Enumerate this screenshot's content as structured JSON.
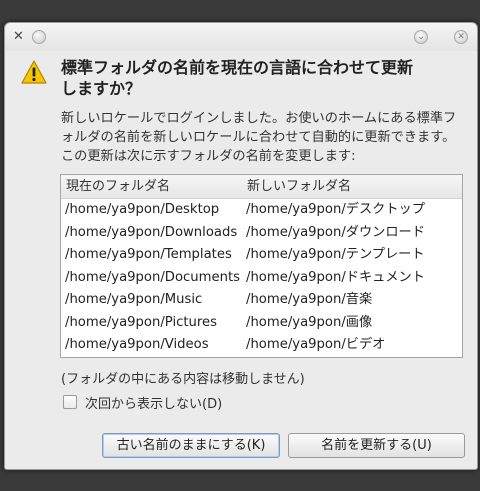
{
  "dialog": {
    "heading": "標準フォルダの名前を現在の言語に合わせて更新しますか？",
    "description": "新しいロケールでログインしました。お使いのホームにある標準フォルダの名前を新しいロケールに合わせて自動的に更新できます。この更新は次に示すフォルダの名前を変更します:",
    "icons": {
      "app": "app-icon",
      "menu": "window-menu-icon",
      "minimize": "minimize-icon",
      "close": "close-icon",
      "warning": "warning-icon"
    }
  },
  "table": {
    "headers": [
      "現在のフォルダ名",
      "新しいフォルダ名"
    ],
    "rows": [
      [
        "/home/ya9pon/Desktop",
        "/home/ya9pon/デスクトップ"
      ],
      [
        "/home/ya9pon/Downloads",
        "/home/ya9pon/ダウンロード"
      ],
      [
        "/home/ya9pon/Templates",
        "/home/ya9pon/テンプレート"
      ],
      [
        "/home/ya9pon/Documents",
        "/home/ya9pon/ドキュメント"
      ],
      [
        "/home/ya9pon/Music",
        "/home/ya9pon/音楽"
      ],
      [
        "/home/ya9pon/Pictures",
        "/home/ya9pon/画像"
      ],
      [
        "/home/ya9pon/Videos",
        "/home/ya9pon/ビデオ"
      ]
    ]
  },
  "note": "(フォルダの中にある内容は移動しません)",
  "checkbox": {
    "label": "次回から表示しない(D)",
    "checked": false
  },
  "buttons": {
    "keep_label": "古い名前のままにする(K)",
    "update_label": "名前を更新する(U)"
  }
}
